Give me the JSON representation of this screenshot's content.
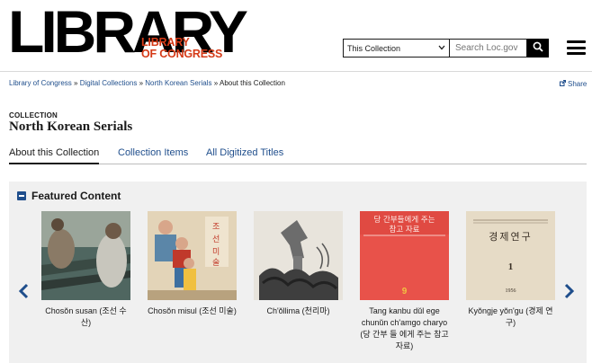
{
  "header": {
    "logo_main": "LIBRARY",
    "logo_sub_line1": "LIBRARY",
    "logo_sub_line2": "OF CONGRESS",
    "search_scope": "This Collection",
    "search_placeholder": "Search Loc.gov",
    "search_icon": "magnifier-icon",
    "menu_icon": "hamburger-icon"
  },
  "breadcrumb": {
    "items": [
      "Library of Congress",
      "Digital Collections",
      "North Korean Serials"
    ],
    "separator": "»",
    "current": "About this Collection"
  },
  "share_label": "Share",
  "collection": {
    "kicker": "COLLECTION",
    "title": "North Korean Serials"
  },
  "tabs": [
    {
      "label": "About this Collection",
      "active": true
    },
    {
      "label": "Collection Items",
      "active": false
    },
    {
      "label": "All Digitized Titles",
      "active": false
    }
  ],
  "featured": {
    "heading": "Featured Content",
    "items": [
      {
        "caption": "Chosŏn susan (조선 수산)"
      },
      {
        "caption": "Chosŏn misul (조선 미술)"
      },
      {
        "caption": "Ch'ŏllima (천리마)"
      },
      {
        "caption": "Tang kanbu dŭl ege chunŭn ch'amgo charyo (당 간부 들 에게 주는 참고 자료)"
      },
      {
        "caption": "Kyŏngje yŏn'gu (경제 연구)"
      }
    ],
    "thumb3_text_top": "당 간부들에게 주는",
    "thumb3_text_mid": "참고 자료",
    "thumb3_number": "9",
    "thumb4_title": "경제연구",
    "thumb4_number": "1",
    "thumb4_year": "1956"
  },
  "colors": {
    "brand_red": "#d53a17",
    "link_blue": "#1f4e8c",
    "panel_bg": "#f0f0f0"
  }
}
